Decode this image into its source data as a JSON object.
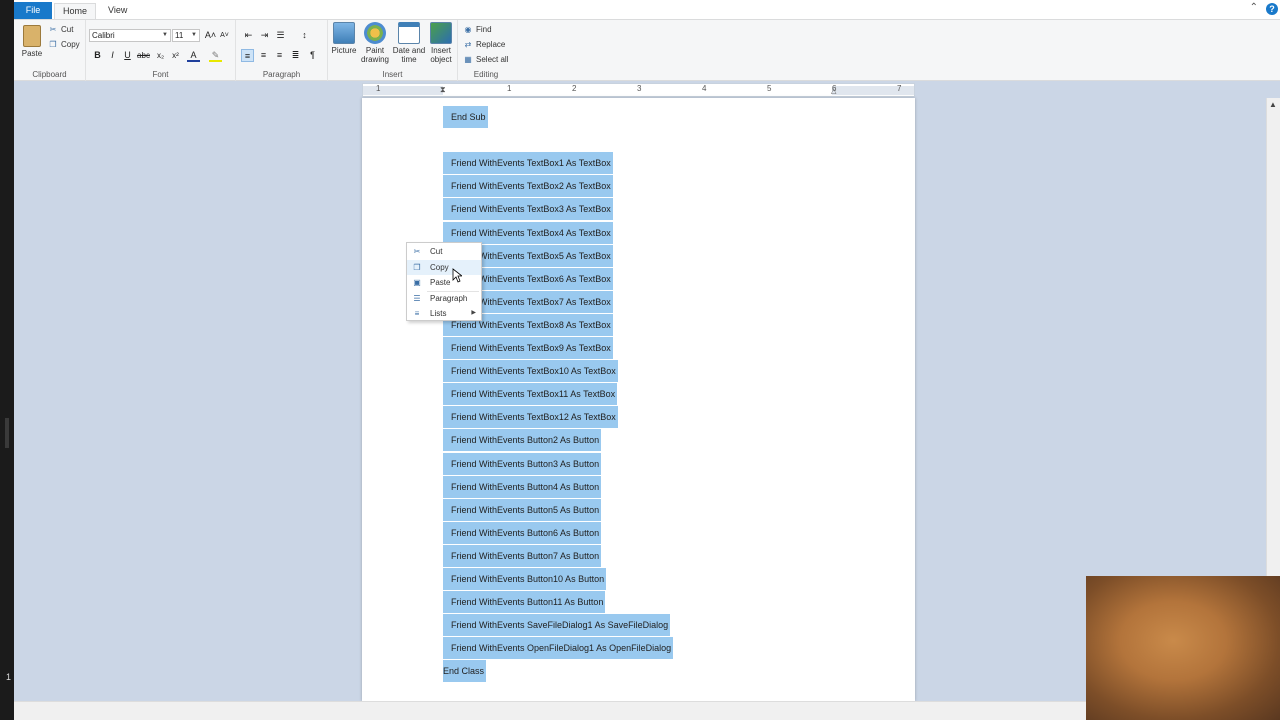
{
  "tabs": {
    "file": "File",
    "home": "Home",
    "view": "View"
  },
  "ribbon": {
    "clipboard": {
      "label": "Clipboard",
      "paste": "Paste",
      "cut": "Cut",
      "copy": "Copy"
    },
    "font": {
      "label": "Font",
      "family": "Calibri",
      "size": "11"
    },
    "paragraph": {
      "label": "Paragraph"
    },
    "insert": {
      "label": "Insert",
      "picture": "Picture",
      "paint_line1": "Paint",
      "paint_line2": "drawing",
      "date_line1": "Date and",
      "date_line2": "time",
      "object_line1": "Insert",
      "object_line2": "object"
    },
    "editing": {
      "label": "Editing",
      "find": "Find",
      "replace": "Replace",
      "select_all": "Select all"
    }
  },
  "ruler": {
    "numbers": [
      "1",
      "1",
      "2",
      "3",
      "4",
      "5",
      "6",
      "7"
    ]
  },
  "document": {
    "lines": [
      "End Sub",
      "",
      "Friend WithEvents TextBox1 As TextBox",
      "Friend WithEvents TextBox2 As TextBox",
      "Friend WithEvents TextBox3 As TextBox",
      "Friend WithEvents TextBox4 As TextBox",
      "Friend WithEvents TextBox5 As TextBox",
      "Friend WithEvents TextBox6 As TextBox",
      "Friend WithEvents TextBox7 As TextBox",
      "Friend WithEvents TextBox8 As TextBox",
      "Friend WithEvents TextBox9 As TextBox",
      "Friend WithEvents TextBox10 As TextBox",
      "Friend WithEvents TextBox11 As TextBox",
      "Friend WithEvents TextBox12 As TextBox",
      "Friend WithEvents Button2 As Button",
      "Friend WithEvents Button3 As Button",
      "Friend WithEvents Button4 As Button",
      "Friend WithEvents Button5 As Button",
      "Friend WithEvents Button6 As Button",
      "Friend WithEvents Button7 As Button",
      "Friend WithEvents Button10 As Button",
      "Friend WithEvents Button11 As Button",
      "Friend WithEvents SaveFileDialog1 As SaveFileDialog",
      "Friend WithEvents OpenFileDialog1 As OpenFileDialog",
      "End Class"
    ]
  },
  "context_menu": {
    "cut": "Cut",
    "copy": "Copy",
    "paste": "Paste",
    "paragraph": "Paragraph",
    "lists": "Lists"
  },
  "taskbar": {
    "left_number": "1"
  },
  "colors": {
    "selection": "#99c9ef",
    "file_tab": "#1979ca",
    "background": "#cbd6e6"
  }
}
